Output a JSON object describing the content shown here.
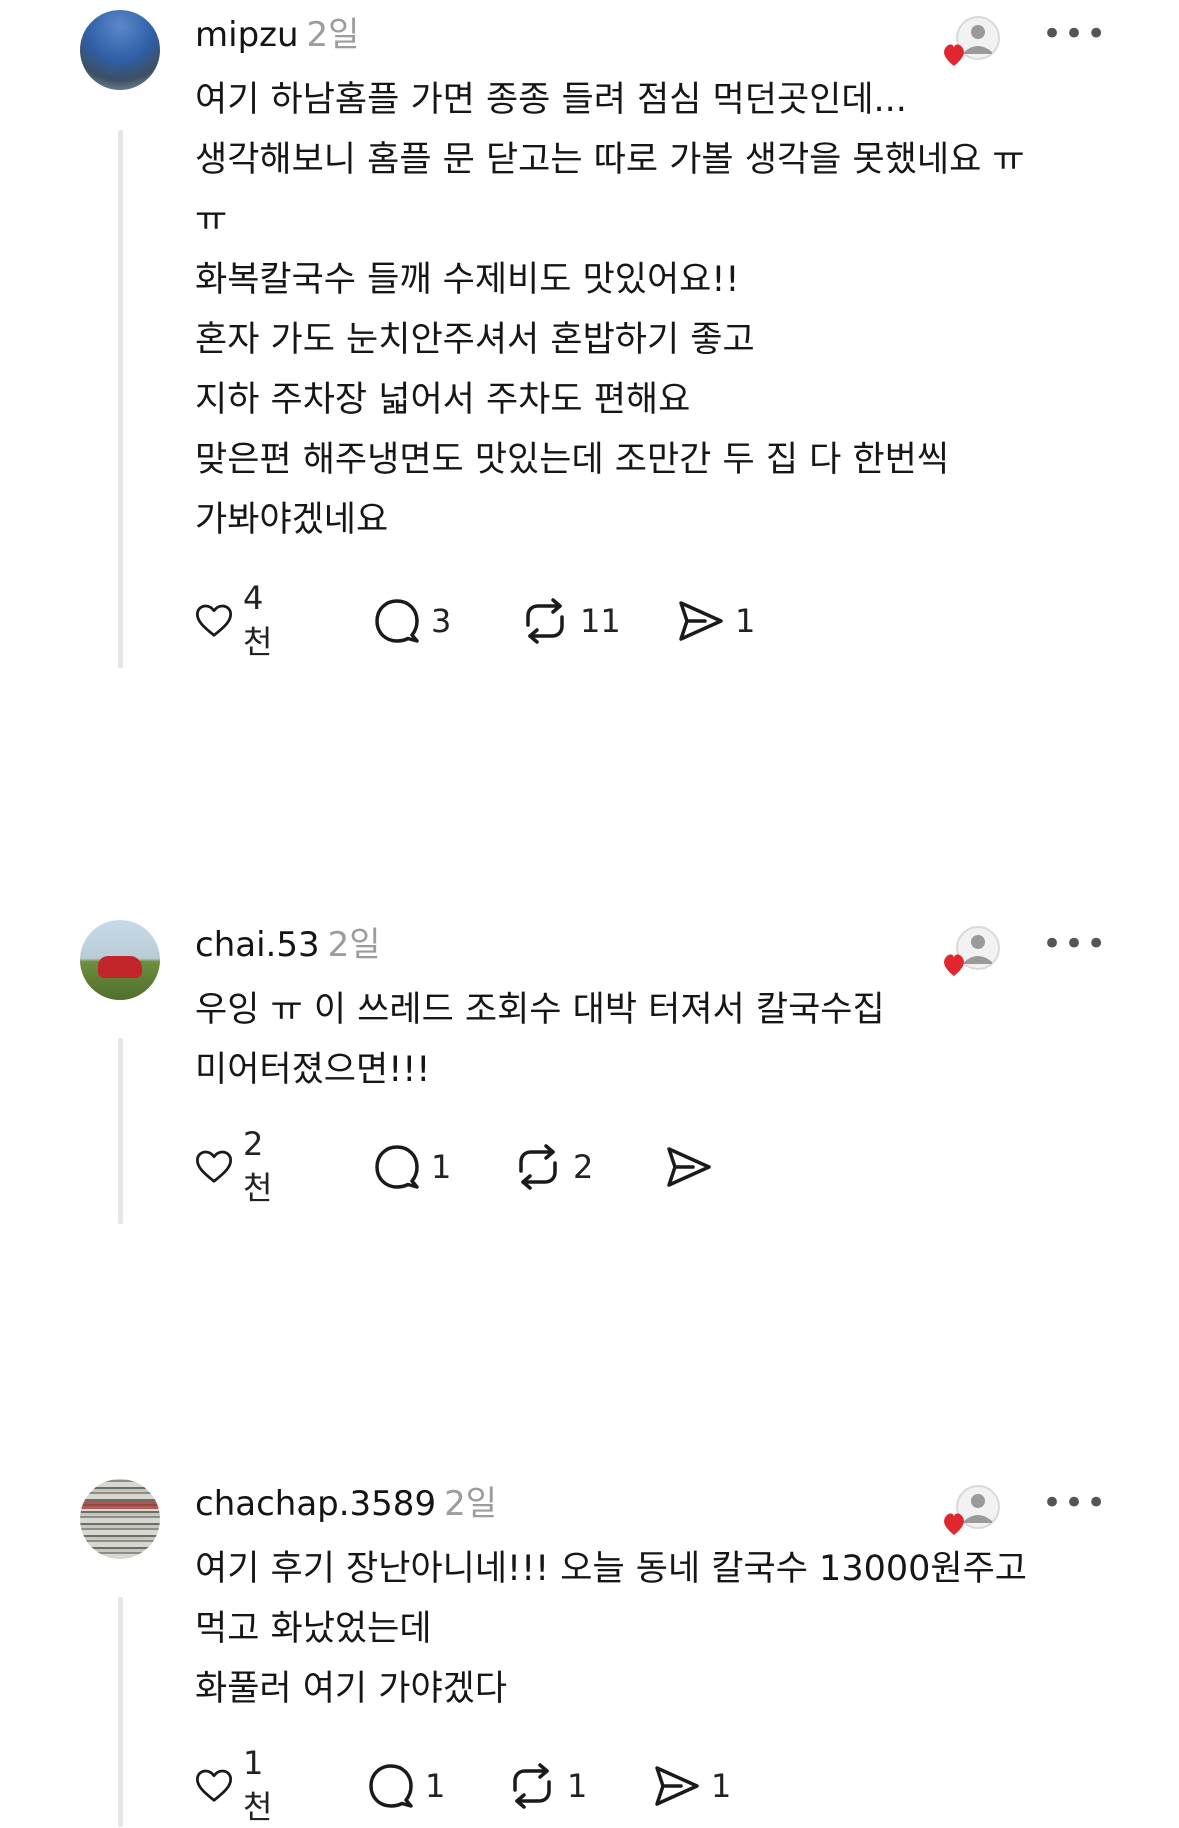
{
  "comments": [
    {
      "username": "mipzu",
      "time": "2일",
      "lines": [
        "여기 하남홈플 가면 종종 들려 점심 먹던곳인데...",
        "생각해보니 홈플 문 닫고는 따로 가볼 생각을 못했네요 ㅠ",
        "ㅠ",
        "화복칼국수 들깨 수제비도 맛있어요!!",
        "혼자 가도 눈치안주셔서 혼밥하기 좋고",
        "지하 주차장 넓어서 주차도 편해요",
        "맞은편 해주냉면도 맛있는데 조만간 두 집 다 한번씩",
        "가봐야겠네요"
      ],
      "likes": "4천",
      "replies": "3",
      "reposts": "11",
      "shares": "1"
    },
    {
      "username": "chai.53",
      "time": "2일",
      "lines": [
        "우잉 ㅠ 이 쓰레드 조회수 대박 터져서 칼국수집",
        "미어터졌으면!!!"
      ],
      "likes": "2천",
      "replies": "1",
      "reposts": "2",
      "shares": ""
    },
    {
      "username": "chachap.3589",
      "time": "2일",
      "lines": [
        "여기 후기 장난아니네!!! 오늘 동네 칼국수 13000원주고",
        "먹고 화났었는데",
        "화풀러 여기 가야겠다"
      ],
      "likes": "1천",
      "replies": "1",
      "reposts": "1",
      "shares": "1"
    }
  ],
  "ui": {
    "more_label": "•••",
    "heart_color": "#e0262f",
    "thread_line_color": "#e6e6e6"
  }
}
